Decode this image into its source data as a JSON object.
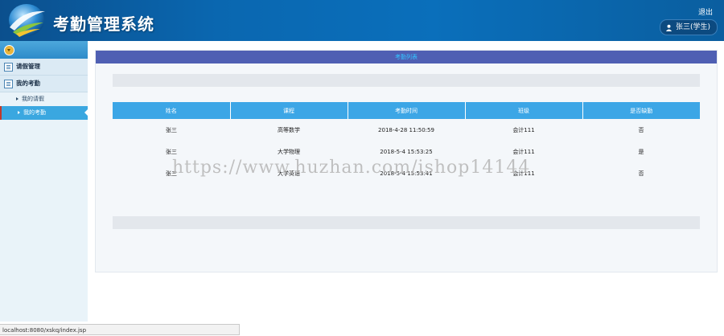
{
  "header": {
    "title": "考勤管理系统",
    "logout": "退出",
    "user": "张三(学生)"
  },
  "sidebar": {
    "groups": [
      {
        "label": "请假管理",
        "items": []
      },
      {
        "label": "我的考勤",
        "items": [
          {
            "label": "我的请假",
            "active": false
          },
          {
            "label": "我的考勤",
            "active": true
          }
        ]
      }
    ]
  },
  "main": {
    "panel_title": "考勤列表",
    "table": {
      "headers": [
        "姓名",
        "课程",
        "考勤时间",
        "班级",
        "是否缺勤"
      ],
      "rows": [
        [
          "张三",
          "高等数学",
          "2018-4-28 11:50:59",
          "会计111",
          "否"
        ],
        [
          "张三",
          "大学物理",
          "2018-5-4 15:53:25",
          "会计111",
          "是"
        ],
        [
          "张三",
          "大学英语",
          "2018-5-4 15:53:41",
          "会计111",
          "否"
        ]
      ]
    }
  },
  "watermark": "https://www.huzhan.com/ishop14144",
  "statusbar": "localhost:8080/xskq/index.jsp"
}
